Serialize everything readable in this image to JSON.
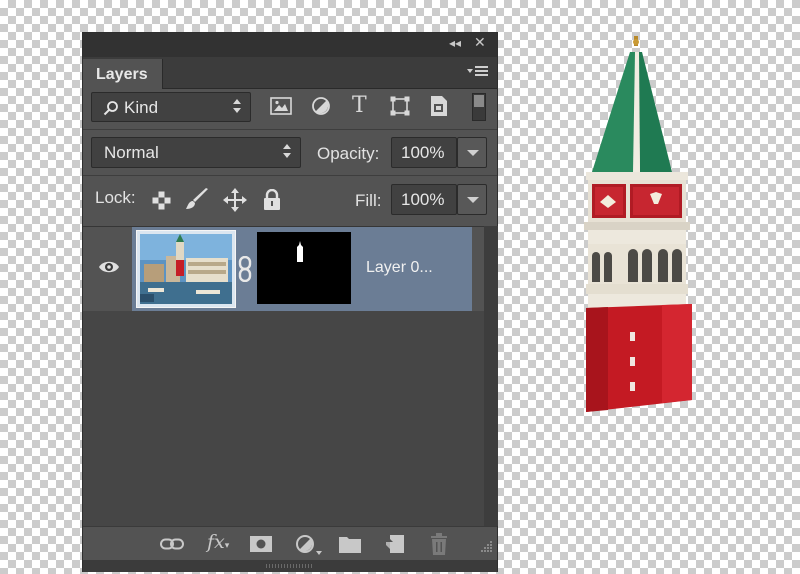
{
  "panel": {
    "collapse_icon": "double-chevron-left-icon",
    "close_icon": "close-icon",
    "tab_label": "Layers",
    "menu_icon": "panel-menu-icon"
  },
  "filter": {
    "kind_label": "Kind",
    "icons": [
      "pixel-filter-icon",
      "adjustment-filter-icon",
      "type-filter-icon",
      "shape-filter-icon",
      "smart-object-filter-icon",
      "filter-toggle-icon"
    ]
  },
  "blend": {
    "mode": "Normal",
    "opacity_label": "Opacity:",
    "opacity_value": "100%"
  },
  "lock": {
    "label": "Lock:",
    "icons": [
      "lock-transparent-pixels-icon",
      "lock-image-pixels-icon",
      "lock-position-icon",
      "lock-all-icon"
    ],
    "fill_label": "Fill:",
    "fill_value": "100%"
  },
  "layers": [
    {
      "name": "Layer 0...",
      "visible": true,
      "has_mask": true,
      "linked": true
    }
  ],
  "footer_icons": [
    "link-layers-icon",
    "layer-style-icon",
    "add-mask-icon",
    "adjustment-layer-icon",
    "new-group-icon",
    "new-layer-icon",
    "delete-layer-icon"
  ],
  "colors": {
    "panel_bg": "#535353",
    "selection": "#6b7d95",
    "tower_roof": "#1f7a52",
    "tower_base": "#c41a23"
  }
}
